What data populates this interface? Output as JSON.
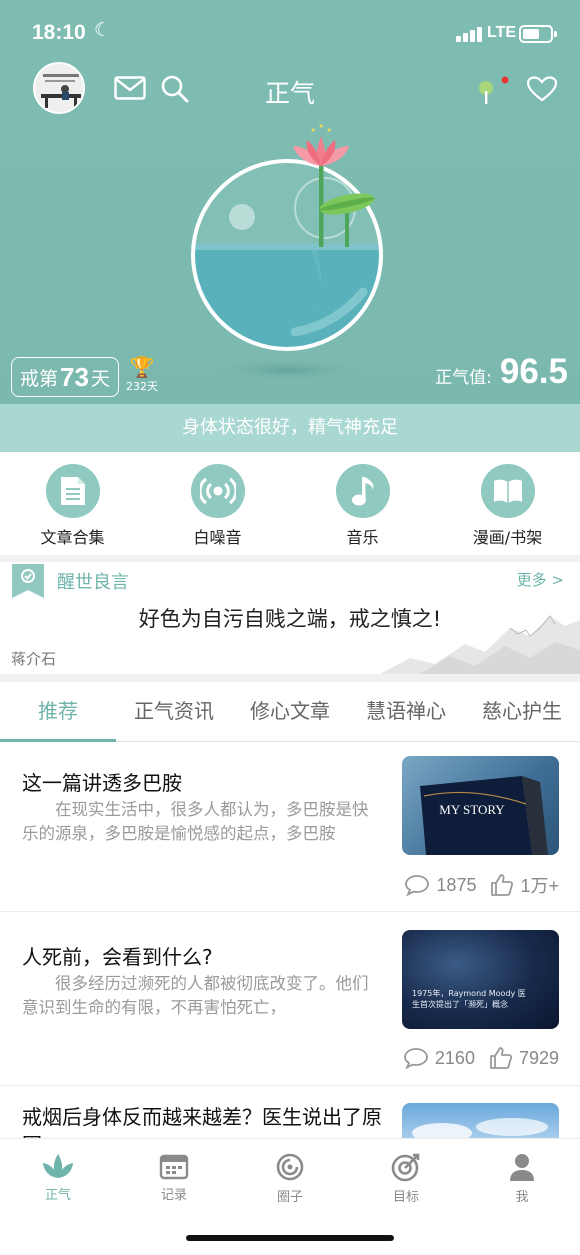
{
  "status_bar": {
    "time": "18:10",
    "network": "LTE"
  },
  "header": {
    "title": "正气"
  },
  "hero": {
    "streak_prefix": "戒第",
    "streak_days": "73",
    "streak_suffix": "天",
    "best_days": "232天",
    "score_label": "正气值:",
    "score_value": "96.5",
    "state_text": "身体状态很好，精气神充足"
  },
  "quick_links": [
    {
      "label": "文章合集",
      "icon": "document-icon"
    },
    {
      "label": "白噪音",
      "icon": "broadcast-icon"
    },
    {
      "label": "音乐",
      "icon": "music-note-icon"
    },
    {
      "label": "漫画/书架",
      "icon": "book-icon"
    }
  ],
  "quote": {
    "title": "醒世良言",
    "more": "更多 >",
    "text": "好色为自污自贱之端，戒之慎之!",
    "author": "蒋介石"
  },
  "tabs": [
    "推荐",
    "正气资讯",
    "修心文章",
    "慧语禅心",
    "慈心护生"
  ],
  "active_tab": 0,
  "articles": [
    {
      "title": "这一篇讲透多巴胺",
      "summary": "在现实生活中，很多人都认为，多巴胺是快乐的源泉，多巴胺是愉悦感的起点，多巴胺",
      "thumb_text": "MY STORY",
      "comments": "1875",
      "likes": "1万+"
    },
    {
      "title": "人死前，会看到什么?",
      "summary": "很多经历过濒死的人都被彻底改变了。他们意识到生命的有限，不再害怕死亡，",
      "thumb_text": "1975年，Raymond Moody 医生首次提出了「濒死」概念",
      "comments": "2160",
      "likes": "7929"
    },
    {
      "title": "戒烟后身体反而越来越差？医生说出了原因"
    }
  ],
  "tab_bar": [
    {
      "label": "正气",
      "icon": "lotus-icon"
    },
    {
      "label": "记录",
      "icon": "calendar-icon"
    },
    {
      "label": "圈子",
      "icon": "circle-icon"
    },
    {
      "label": "目标",
      "icon": "target-icon"
    },
    {
      "label": "我",
      "icon": "person-icon"
    }
  ],
  "colors": {
    "accent": "#6fb4ab",
    "hero_bg": "#7fbdb3",
    "state_bar": "#a9d7d1"
  }
}
